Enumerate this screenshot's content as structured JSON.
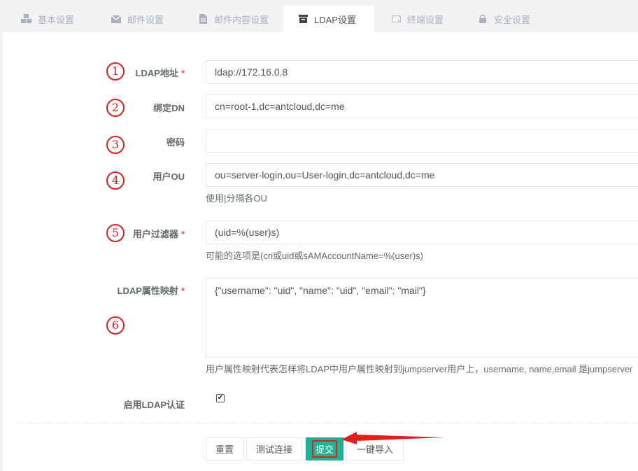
{
  "tabs": [
    {
      "label": "基本设置",
      "icon": "cubes-icon"
    },
    {
      "label": "邮件设置",
      "icon": "envelope-icon"
    },
    {
      "label": "邮件内容设置",
      "icon": "file-icon"
    },
    {
      "label": "LDAP设置",
      "icon": "archive-icon"
    },
    {
      "label": "终端设置",
      "icon": "hdd-icon"
    },
    {
      "label": "安全设置",
      "icon": "lock-icon"
    }
  ],
  "form": {
    "server_uri": {
      "label": "LDAP地址",
      "required": "*",
      "value": "ldap://172.16.0.8",
      "marker": "1"
    },
    "bind_dn": {
      "label": "绑定DN",
      "value": "cn=root-1,dc=antcloud,dc=me",
      "marker": "2"
    },
    "password": {
      "label": "密码",
      "value": "",
      "marker": "3"
    },
    "search_ou": {
      "label": "用户OU",
      "value": "ou=server-login,ou=User-login,dc=antcloud,dc=me",
      "help": "使用|分隔各OU",
      "marker": "4"
    },
    "search_filter": {
      "label": "用户过滤器",
      "required": "*",
      "value": "(uid=%(user)s)",
      "help": "可能的选项是(cn或uid或sAMAccountName=%(user)s)",
      "marker": "5"
    },
    "attr_map": {
      "label": "LDAP属性映射",
      "required": "*",
      "value": "{\"username\": \"uid\", \"name\": \"uid\", \"email\": \"mail\"}",
      "help": "用户属性映射代表怎样将LDAP中用户属性映射到jumpserver用户上，username, name,email 是jumpserver",
      "marker": "6"
    },
    "auth_ldap": {
      "label": "启用LDAP认证",
      "checked": "✔"
    }
  },
  "buttons": {
    "reset": "重置",
    "test": "测试连接",
    "submit": "提交",
    "import": "一键导入"
  },
  "colors": {
    "primary": "#1ab394",
    "annotation": "#e02020",
    "required": "#ed5565"
  }
}
